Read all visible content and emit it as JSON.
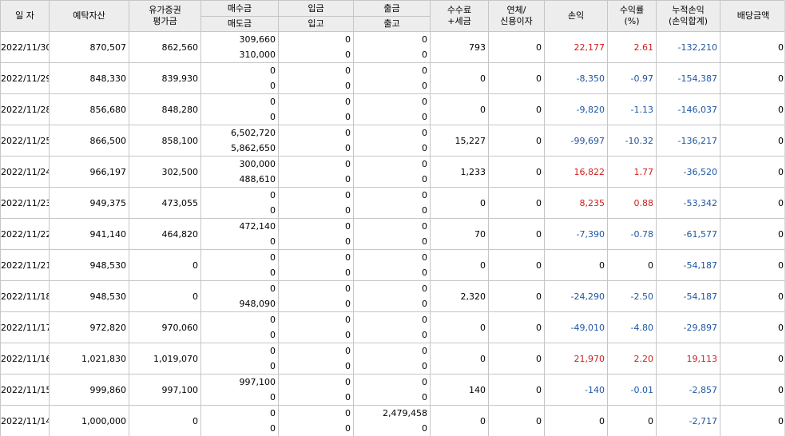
{
  "headers": {
    "date": "일 자",
    "deposit_assets": "예탁자산",
    "securities_eval_l1": "유가증권",
    "securities_eval_l2": "평가금",
    "buy_amount": "매수금",
    "sell_amount": "매도금",
    "deposit": "입금",
    "transfer_in": "입고",
    "withdrawal": "출금",
    "transfer_out": "출고",
    "fee_tax_l1": "수수료",
    "fee_tax_l2": "+세금",
    "overdue_l1": "연체/",
    "overdue_l2": "신용이자",
    "pnl": "손익",
    "return_l1": "수익률",
    "return_l2": "(%)",
    "cum_pnl_l1": "누적손익",
    "cum_pnl_l2": "(손익합계)",
    "dividend": "배당금액"
  },
  "rows": [
    {
      "date": "2022/11/30",
      "deposit_assets": "870,507",
      "securities_eval": "862,560",
      "buy": "309,660",
      "sell": "310,000",
      "deposit": "0",
      "transfer_in": "0",
      "withdrawal": "0",
      "transfer_out": "0",
      "fee_tax": "793",
      "overdue": "0",
      "pnl": "22,177",
      "return": "2.61",
      "cum_pnl": "-132,210",
      "dividend": "0"
    },
    {
      "date": "2022/11/29",
      "deposit_assets": "848,330",
      "securities_eval": "839,930",
      "buy": "0",
      "sell": "0",
      "deposit": "0",
      "transfer_in": "0",
      "withdrawal": "0",
      "transfer_out": "0",
      "fee_tax": "0",
      "overdue": "0",
      "pnl": "-8,350",
      "return": "-0.97",
      "cum_pnl": "-154,387",
      "dividend": "0"
    },
    {
      "date": "2022/11/28",
      "deposit_assets": "856,680",
      "securities_eval": "848,280",
      "buy": "0",
      "sell": "0",
      "deposit": "0",
      "transfer_in": "0",
      "withdrawal": "0",
      "transfer_out": "0",
      "fee_tax": "0",
      "overdue": "0",
      "pnl": "-9,820",
      "return": "-1.13",
      "cum_pnl": "-146,037",
      "dividend": "0"
    },
    {
      "date": "2022/11/25",
      "deposit_assets": "866,500",
      "securities_eval": "858,100",
      "buy": "6,502,720",
      "sell": "5,862,650",
      "deposit": "0",
      "transfer_in": "0",
      "withdrawal": "0",
      "transfer_out": "0",
      "fee_tax": "15,227",
      "overdue": "0",
      "pnl": "-99,697",
      "return": "-10.32",
      "cum_pnl": "-136,217",
      "dividend": "0"
    },
    {
      "date": "2022/11/24",
      "deposit_assets": "966,197",
      "securities_eval": "302,500",
      "buy": "300,000",
      "sell": "488,610",
      "deposit": "0",
      "transfer_in": "0",
      "withdrawal": "0",
      "transfer_out": "0",
      "fee_tax": "1,233",
      "overdue": "0",
      "pnl": "16,822",
      "return": "1.77",
      "cum_pnl": "-36,520",
      "dividend": "0"
    },
    {
      "date": "2022/11/23",
      "deposit_assets": "949,375",
      "securities_eval": "473,055",
      "buy": "0",
      "sell": "0",
      "deposit": "0",
      "transfer_in": "0",
      "withdrawal": "0",
      "transfer_out": "0",
      "fee_tax": "0",
      "overdue": "0",
      "pnl": "8,235",
      "return": "0.88",
      "cum_pnl": "-53,342",
      "dividend": "0"
    },
    {
      "date": "2022/11/22",
      "deposit_assets": "941,140",
      "securities_eval": "464,820",
      "buy": "472,140",
      "sell": "0",
      "deposit": "0",
      "transfer_in": "0",
      "withdrawal": "0",
      "transfer_out": "0",
      "fee_tax": "70",
      "overdue": "0",
      "pnl": "-7,390",
      "return": "-0.78",
      "cum_pnl": "-61,577",
      "dividend": "0"
    },
    {
      "date": "2022/11/21",
      "deposit_assets": "948,530",
      "securities_eval": "0",
      "buy": "0",
      "sell": "0",
      "deposit": "0",
      "transfer_in": "0",
      "withdrawal": "0",
      "transfer_out": "0",
      "fee_tax": "0",
      "overdue": "0",
      "pnl": "0",
      "return": "0",
      "cum_pnl": "-54,187",
      "dividend": "0"
    },
    {
      "date": "2022/11/18",
      "deposit_assets": "948,530",
      "securities_eval": "0",
      "buy": "0",
      "sell": "948,090",
      "deposit": "0",
      "transfer_in": "0",
      "withdrawal": "0",
      "transfer_out": "0",
      "fee_tax": "2,320",
      "overdue": "0",
      "pnl": "-24,290",
      "return": "-2.50",
      "cum_pnl": "-54,187",
      "dividend": "0"
    },
    {
      "date": "2022/11/17",
      "deposit_assets": "972,820",
      "securities_eval": "970,060",
      "buy": "0",
      "sell": "0",
      "deposit": "0",
      "transfer_in": "0",
      "withdrawal": "0",
      "transfer_out": "0",
      "fee_tax": "0",
      "overdue": "0",
      "pnl": "-49,010",
      "return": "-4.80",
      "cum_pnl": "-29,897",
      "dividend": "0"
    },
    {
      "date": "2022/11/16",
      "deposit_assets": "1,021,830",
      "securities_eval": "1,019,070",
      "buy": "0",
      "sell": "0",
      "deposit": "0",
      "transfer_in": "0",
      "withdrawal": "0",
      "transfer_out": "0",
      "fee_tax": "0",
      "overdue": "0",
      "pnl": "21,970",
      "return": "2.20",
      "cum_pnl": "19,113",
      "dividend": "0"
    },
    {
      "date": "2022/11/15",
      "deposit_assets": "999,860",
      "securities_eval": "997,100",
      "buy": "997,100",
      "sell": "0",
      "deposit": "0",
      "transfer_in": "0",
      "withdrawal": "0",
      "transfer_out": "0",
      "fee_tax": "140",
      "overdue": "0",
      "pnl": "-140",
      "return": "-0.01",
      "cum_pnl": "-2,857",
      "dividend": "0"
    },
    {
      "date": "2022/11/14",
      "deposit_assets": "1,000,000",
      "securities_eval": "0",
      "buy": "0",
      "sell": "0",
      "deposit": "0",
      "transfer_in": "0",
      "withdrawal": "2,479,458",
      "transfer_out": "0",
      "fee_tax": "0",
      "overdue": "0",
      "pnl": "0",
      "return": "0",
      "cum_pnl": "-2,717",
      "dividend": "0"
    }
  ],
  "colors": {
    "negative": "#1f57a3",
    "positive": "#d01d1d",
    "header_bg": "#ededed",
    "grid_line": "#c6c6c6"
  }
}
